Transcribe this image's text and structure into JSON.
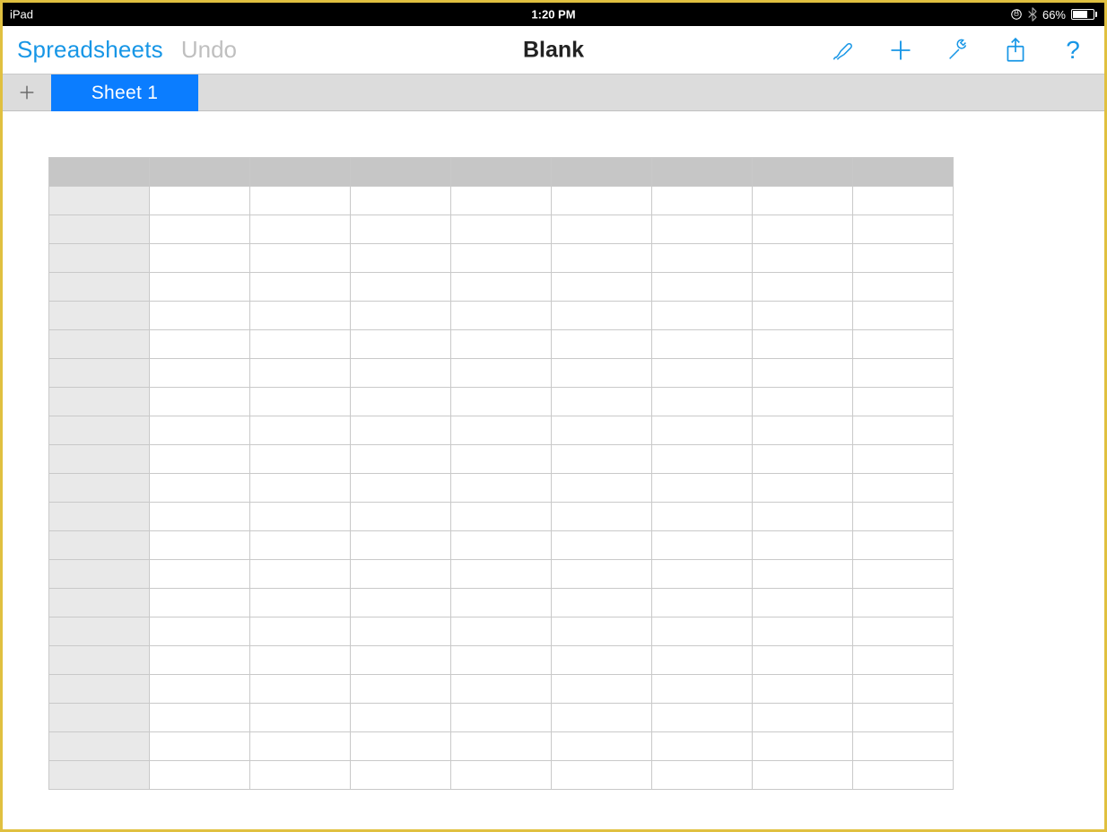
{
  "statusbar": {
    "device": "iPad",
    "time": "1:20 PM",
    "battery_pct": "66%"
  },
  "toolbar": {
    "back_label": "Spreadsheets",
    "undo_label": "Undo",
    "title": "Blank",
    "help_glyph": "?"
  },
  "sheetbar": {
    "active_tab_label": "Sheet 1"
  },
  "grid": {
    "columns": 9,
    "rows": 21,
    "column_headers": [
      "",
      "",
      "",
      "",
      "",
      "",
      "",
      "",
      ""
    ],
    "cells": []
  },
  "colors": {
    "accent": "#1796e6",
    "tab_active": "#0b7dff",
    "frame": "#e0c040"
  }
}
